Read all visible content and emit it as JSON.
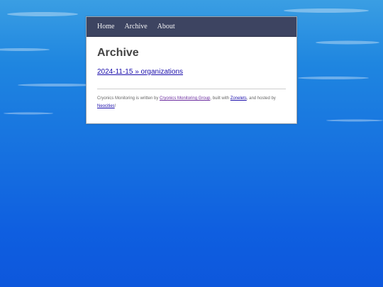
{
  "nav": {
    "items": [
      {
        "label": "Home"
      },
      {
        "label": "Archive"
      },
      {
        "label": "About"
      }
    ]
  },
  "page": {
    "title": "Archive",
    "posts": [
      {
        "label": "2024-11-15 » organizations"
      }
    ]
  },
  "footer": {
    "text1": "Cryonics Monitoring is written by ",
    "link_group": "Cryonics Monitoring Group",
    "text2": ", built with ",
    "link_zonelets": "Zonelets",
    "text3": ", and hosted by ",
    "link_neocities": "Neocities",
    "text4": "!"
  },
  "colors": {
    "nav_bg": "#3d4461",
    "link": "#1a0dab",
    "visited_link": "#6a2a9e",
    "background_top": "#3a9ee3",
    "background_bottom": "#0d57dc"
  }
}
